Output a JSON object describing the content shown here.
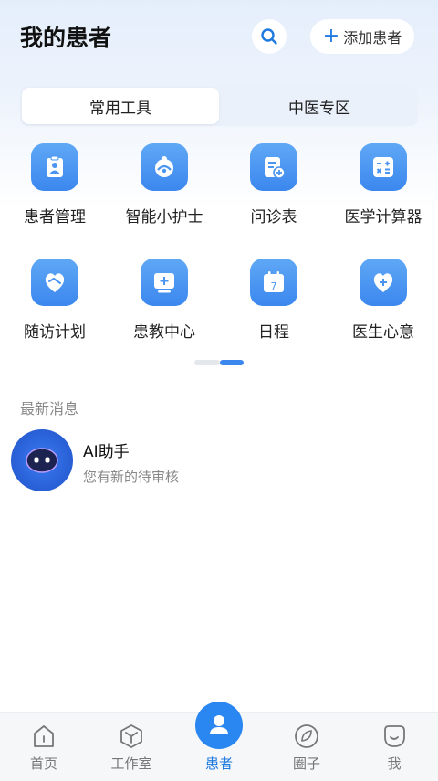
{
  "header": {
    "title": "我的患者",
    "add_patient_label": "添加患者"
  },
  "segment": {
    "tabs": [
      {
        "label": "常用工具",
        "active": true
      },
      {
        "label": "中医专区",
        "active": false
      }
    ]
  },
  "tools": [
    {
      "label": "患者管理",
      "icon": "clipboard-person-icon"
    },
    {
      "label": "智能小护士",
      "icon": "nurse-icon"
    },
    {
      "label": "问诊表",
      "icon": "form-add-icon"
    },
    {
      "label": "医学计算器",
      "icon": "calculator-icon"
    },
    {
      "label": "随访计划",
      "icon": "heart-handshake-icon"
    },
    {
      "label": "患教中心",
      "icon": "education-board-icon"
    },
    {
      "label": "日程",
      "icon": "calendar-icon"
    },
    {
      "label": "医生心意",
      "icon": "heart-plus-icon"
    }
  ],
  "pager": {
    "pages": 2,
    "active": 2
  },
  "messages": {
    "section_label": "最新消息",
    "items": [
      {
        "name": "AI助手",
        "preview": "您有新的待审核"
      }
    ]
  },
  "tabbar": {
    "items": [
      {
        "label": "首页",
        "icon": "home-icon"
      },
      {
        "label": "工作室",
        "icon": "cube-icon"
      },
      {
        "label": "患者",
        "icon": "person-icon",
        "active": true
      },
      {
        "label": "圈子",
        "icon": "leaf-circle-icon"
      },
      {
        "label": "我",
        "icon": "smile-icon"
      }
    ]
  },
  "colors": {
    "accent": "#1f7ae0",
    "icon_blue": "#3b87ee"
  }
}
